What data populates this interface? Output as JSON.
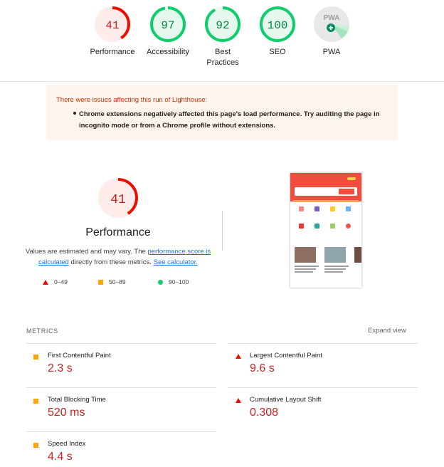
{
  "scores": [
    {
      "label": "Performance",
      "value": "41",
      "score": 0.41,
      "status": "fail",
      "color": "#eb0f00",
      "bg": "#fdecea"
    },
    {
      "label": "Accessibility",
      "value": "97",
      "score": 0.97,
      "status": "pass",
      "color": "#0cce6b",
      "bg": "#e6f8ee"
    },
    {
      "label": "Best\nPractices",
      "value": "92",
      "score": 0.92,
      "status": "pass",
      "color": "#0cce6b",
      "bg": "#e6f8ee"
    },
    {
      "label": "SEO",
      "value": "100",
      "score": 1.0,
      "status": "pass",
      "color": "#0cce6b",
      "bg": "#e6f8ee"
    },
    {
      "label": "PWA",
      "value": "",
      "badge": "PWA",
      "icon": "pwa-badge-icon",
      "color": "#0cce6b",
      "bg": "#e8e8e8"
    }
  ],
  "warning": {
    "title": "There were issues affecting this run of Lighthouse:",
    "item": "Chrome extensions negatively affected this page's load performance. Try auditing the page in incognito mode or from a Chrome profile without extensions.",
    "color": "#c33300"
  },
  "performance": {
    "score": "41",
    "score_fraction": 0.41,
    "title": "Performance",
    "desc_prefix": "Values are estimated and may vary. The ",
    "link1": "performance score is calculated",
    "desc_mid": " directly from these metrics. ",
    "link2": "See calculator.",
    "legend": [
      {
        "icon": "triangle-fail-icon",
        "range": "0–49"
      },
      {
        "icon": "square-average-icon",
        "range": "50–89"
      },
      {
        "icon": "circle-pass-icon",
        "range": "90–100"
      }
    ]
  },
  "metrics": {
    "heading": "METRICS",
    "expand_label": "Expand view",
    "items": [
      {
        "label": "First Contentful Paint",
        "value": "2.3 s",
        "status": "average",
        "icon": "square-average-icon"
      },
      {
        "label": "Largest Contentful Paint",
        "value": "9.6 s",
        "status": "fail",
        "icon": "triangle-fail-icon"
      },
      {
        "label": "Total Blocking Time",
        "value": "520 ms",
        "status": "average",
        "icon": "square-average-icon"
      },
      {
        "label": "Cumulative Layout Shift",
        "value": "0.308",
        "status": "fail",
        "icon": "triangle-fail-icon"
      },
      {
        "label": "Speed Index",
        "value": "4.4 s",
        "status": "average",
        "icon": "square-average-icon"
      }
    ]
  },
  "colors": {
    "fail": "#eb0f00",
    "average": "#ffa400",
    "pass": "#0cce6b",
    "value_red": "#c7221f",
    "link": "#1a73e8"
  }
}
